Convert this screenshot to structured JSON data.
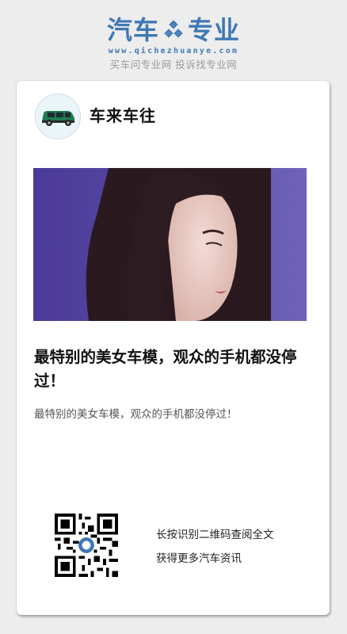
{
  "brand": {
    "logo_left": "汽车",
    "logo_right": "专业",
    "url": "www.qichezhuanye.com",
    "tagline": "买车问专业网 投诉找专业网",
    "color": "#3f78b5"
  },
  "account": {
    "name": "车来车往",
    "avatar_icon": "car-icon"
  },
  "article": {
    "image_icon": "photo",
    "title": "最特别的美女车模，观众的手机都没停过！",
    "summary": "最特别的美女车模，观众的手机都没停过！"
  },
  "footer": {
    "qr_icon": "qr-code-icon",
    "hint_line1": "长按识别二维码查阅全文",
    "hint_line2": "获得更多汽车资讯"
  }
}
